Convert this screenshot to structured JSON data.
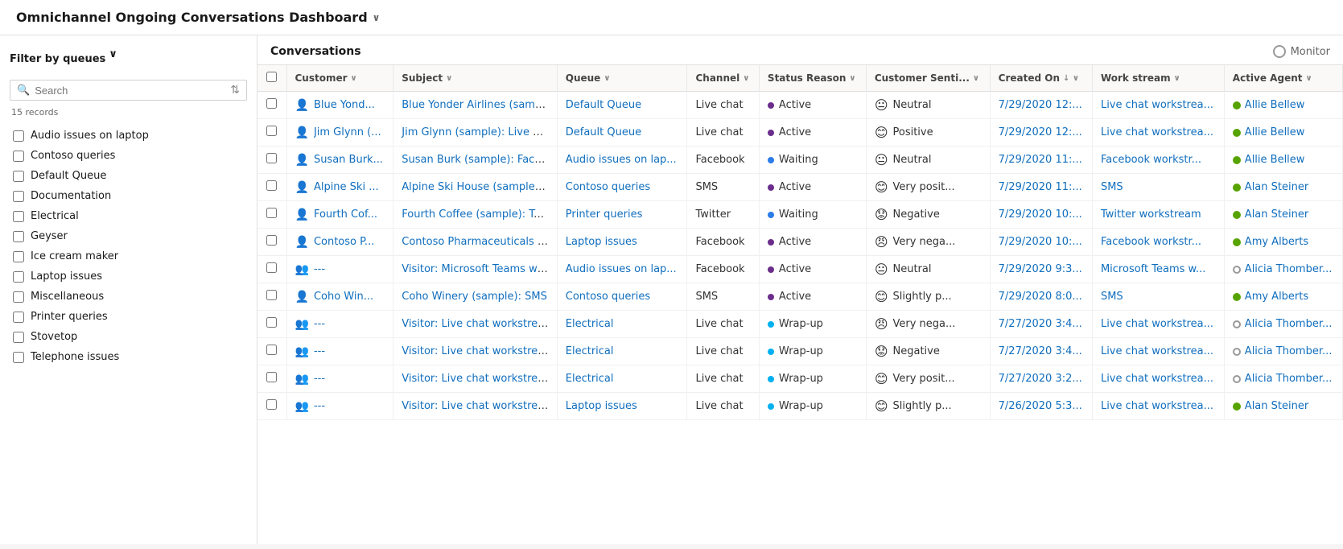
{
  "header": {
    "title": "Omnichannel Ongoing Conversations Dashboard",
    "chevron": "∨"
  },
  "sidebar": {
    "filter_label": "Filter by queues",
    "filter_chevron": "∨",
    "search_placeholder": "Search",
    "records_count": "15 records",
    "sort_icon": "⇅",
    "queues": [
      {
        "id": "audio",
        "label": "Audio issues on laptop"
      },
      {
        "id": "contoso",
        "label": "Contoso queries"
      },
      {
        "id": "default",
        "label": "Default Queue"
      },
      {
        "id": "documentation",
        "label": "Documentation"
      },
      {
        "id": "electrical",
        "label": "Electrical"
      },
      {
        "id": "geyser",
        "label": "Geyser"
      },
      {
        "id": "icecream",
        "label": "Ice cream maker"
      },
      {
        "id": "laptop",
        "label": "Laptop issues"
      },
      {
        "id": "misc",
        "label": "Miscellaneous"
      },
      {
        "id": "printer",
        "label": "Printer queries"
      },
      {
        "id": "stovetop",
        "label": "Stovetop"
      },
      {
        "id": "telephone",
        "label": "Telephone issues"
      }
    ]
  },
  "conversations": {
    "title": "Conversations",
    "monitor_label": "Monitor",
    "columns": {
      "customer": "Customer",
      "subject": "Subject",
      "queue": "Queue",
      "channel": "Channel",
      "status_reason": "Status Reason",
      "customer_sentiment": "Customer Senti...",
      "created_on": "Created On",
      "work_stream": "Work stream",
      "active_agent": "Active Agent"
    },
    "rows": [
      {
        "customer_icon": "person",
        "customer": "Blue Yond...",
        "subject": "Blue Yonder Airlines (sample): Live c...",
        "queue": "Default Queue",
        "channel": "Live chat",
        "status": "Active",
        "status_dot": "active",
        "sentiment_icon": "😐",
        "sentiment": "Neutral",
        "created_on": "7/29/2020 12:...",
        "workstream": "Live chat workstrea...",
        "agent_status": "online",
        "agent": "Allie Bellew"
      },
      {
        "customer_icon": "person",
        "customer": "Jim Glynn (...",
        "subject": "Jim Glynn (sample): Live chat works...",
        "queue": "Default Queue",
        "channel": "Live chat",
        "status": "Active",
        "status_dot": "active",
        "sentiment_icon": "😊",
        "sentiment": "Positive",
        "created_on": "7/29/2020 12:...",
        "workstream": "Live chat workstrea...",
        "agent_status": "online",
        "agent": "Allie Bellew"
      },
      {
        "customer_icon": "person",
        "customer": "Susan Burk...",
        "subject": "Susan Burk (sample): Facebook wor...",
        "queue": "Audio issues on lap...",
        "channel": "Facebook",
        "status": "Waiting",
        "status_dot": "waiting",
        "sentiment_icon": "😐",
        "sentiment": "Neutral",
        "created_on": "7/29/2020 11:...",
        "workstream": "Facebook workstr...",
        "agent_status": "online",
        "agent": "Allie Bellew"
      },
      {
        "customer_icon": "person",
        "customer": "Alpine Ski ...",
        "subject": "Alpine Ski House (sample): SMS",
        "queue": "Contoso queries",
        "channel": "SMS",
        "status": "Active",
        "status_dot": "active",
        "sentiment_icon": "😊",
        "sentiment": "Very posit...",
        "created_on": "7/29/2020 11:...",
        "workstream": "SMS",
        "agent_status": "online",
        "agent": "Alan Steiner"
      },
      {
        "customer_icon": "person",
        "customer": "Fourth Cof...",
        "subject": "Fourth Coffee (sample): Twitter wor...",
        "queue": "Printer queries",
        "channel": "Twitter",
        "status": "Waiting",
        "status_dot": "waiting",
        "sentiment_icon": "😟",
        "sentiment": "Negative",
        "created_on": "7/29/2020 10:...",
        "workstream": "Twitter workstream",
        "agent_status": "online",
        "agent": "Alan Steiner"
      },
      {
        "customer_icon": "person",
        "customer": "Contoso P...",
        "subject": "Contoso Pharmaceuticals (sample):...",
        "queue": "Laptop issues",
        "channel": "Facebook",
        "status": "Active",
        "status_dot": "active",
        "sentiment_icon": "😠",
        "sentiment": "Very nega...",
        "created_on": "7/29/2020 10:...",
        "workstream": "Facebook workstr...",
        "agent_status": "online",
        "agent": "Amy Alberts"
      },
      {
        "customer_icon": "group",
        "customer": "---",
        "subject": "Visitor: Microsoft Teams workstrea...",
        "queue": "Audio issues on lap...",
        "channel": "Facebook",
        "status": "Active",
        "status_dot": "active",
        "sentiment_icon": "😐",
        "sentiment": "Neutral",
        "created_on": "7/29/2020 9:3...",
        "workstream": "Microsoft Teams w...",
        "agent_status": "offline",
        "agent": "Alicia Thomber..."
      },
      {
        "customer_icon": "person",
        "customer": "Coho Win...",
        "subject": "Coho Winery (sample): SMS",
        "queue": "Contoso queries",
        "channel": "SMS",
        "status": "Active",
        "status_dot": "active",
        "sentiment_icon": "😊",
        "sentiment": "Slightly p...",
        "created_on": "7/29/2020 8:0...",
        "workstream": "SMS",
        "agent_status": "online",
        "agent": "Amy Alberts"
      },
      {
        "customer_icon": "group",
        "customer": "---",
        "subject": "Visitor: Live chat workstream",
        "queue": "Electrical",
        "channel": "Live chat",
        "status": "Wrap-up",
        "status_dot": "wrapup",
        "sentiment_icon": "😠",
        "sentiment": "Very nega...",
        "created_on": "7/27/2020 3:4...",
        "workstream": "Live chat workstrea...",
        "agent_status": "offline",
        "agent": "Alicia Thomber..."
      },
      {
        "customer_icon": "group",
        "customer": "---",
        "subject": "Visitor: Live chat workstream",
        "queue": "Electrical",
        "channel": "Live chat",
        "status": "Wrap-up",
        "status_dot": "wrapup",
        "sentiment_icon": "😟",
        "sentiment": "Negative",
        "created_on": "7/27/2020 3:4...",
        "workstream": "Live chat workstrea...",
        "agent_status": "offline",
        "agent": "Alicia Thomber..."
      },
      {
        "customer_icon": "group",
        "customer": "---",
        "subject": "Visitor: Live chat workstream",
        "queue": "Electrical",
        "channel": "Live chat",
        "status": "Wrap-up",
        "status_dot": "wrapup",
        "sentiment_icon": "😊",
        "sentiment": "Very posit...",
        "created_on": "7/27/2020 3:2...",
        "workstream": "Live chat workstrea...",
        "agent_status": "offline",
        "agent": "Alicia Thomber..."
      },
      {
        "customer_icon": "group",
        "customer": "---",
        "subject": "Visitor: Live chat workstream",
        "queue": "Laptop issues",
        "channel": "Live chat",
        "status": "Wrap-up",
        "status_dot": "wrapup",
        "sentiment_icon": "😊",
        "sentiment": "Slightly p...",
        "created_on": "7/26/2020 5:3...",
        "workstream": "Live chat workstrea...",
        "agent_status": "online",
        "agent": "Alan Steiner"
      }
    ]
  }
}
